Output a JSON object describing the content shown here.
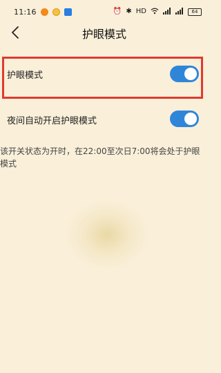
{
  "status_bar": {
    "time": "11:16",
    "icons": [
      "alarm-icon",
      "bluetooth-icon",
      "wifi-icon",
      "signal-icon",
      "signal-icon"
    ],
    "network_badge": "HD",
    "battery": "64"
  },
  "header": {
    "title": "护眼模式"
  },
  "settings": [
    {
      "label": "护眼模式",
      "enabled": true
    },
    {
      "label": "夜间自动开启护眼模式",
      "enabled": true
    }
  ],
  "description": "该开关状态为开时，在22:00至次日7:00将会处于护眼模式",
  "colors": {
    "background": "#faefd9",
    "toggle_on": "#2f86d9",
    "highlight": "#e03a2f"
  }
}
